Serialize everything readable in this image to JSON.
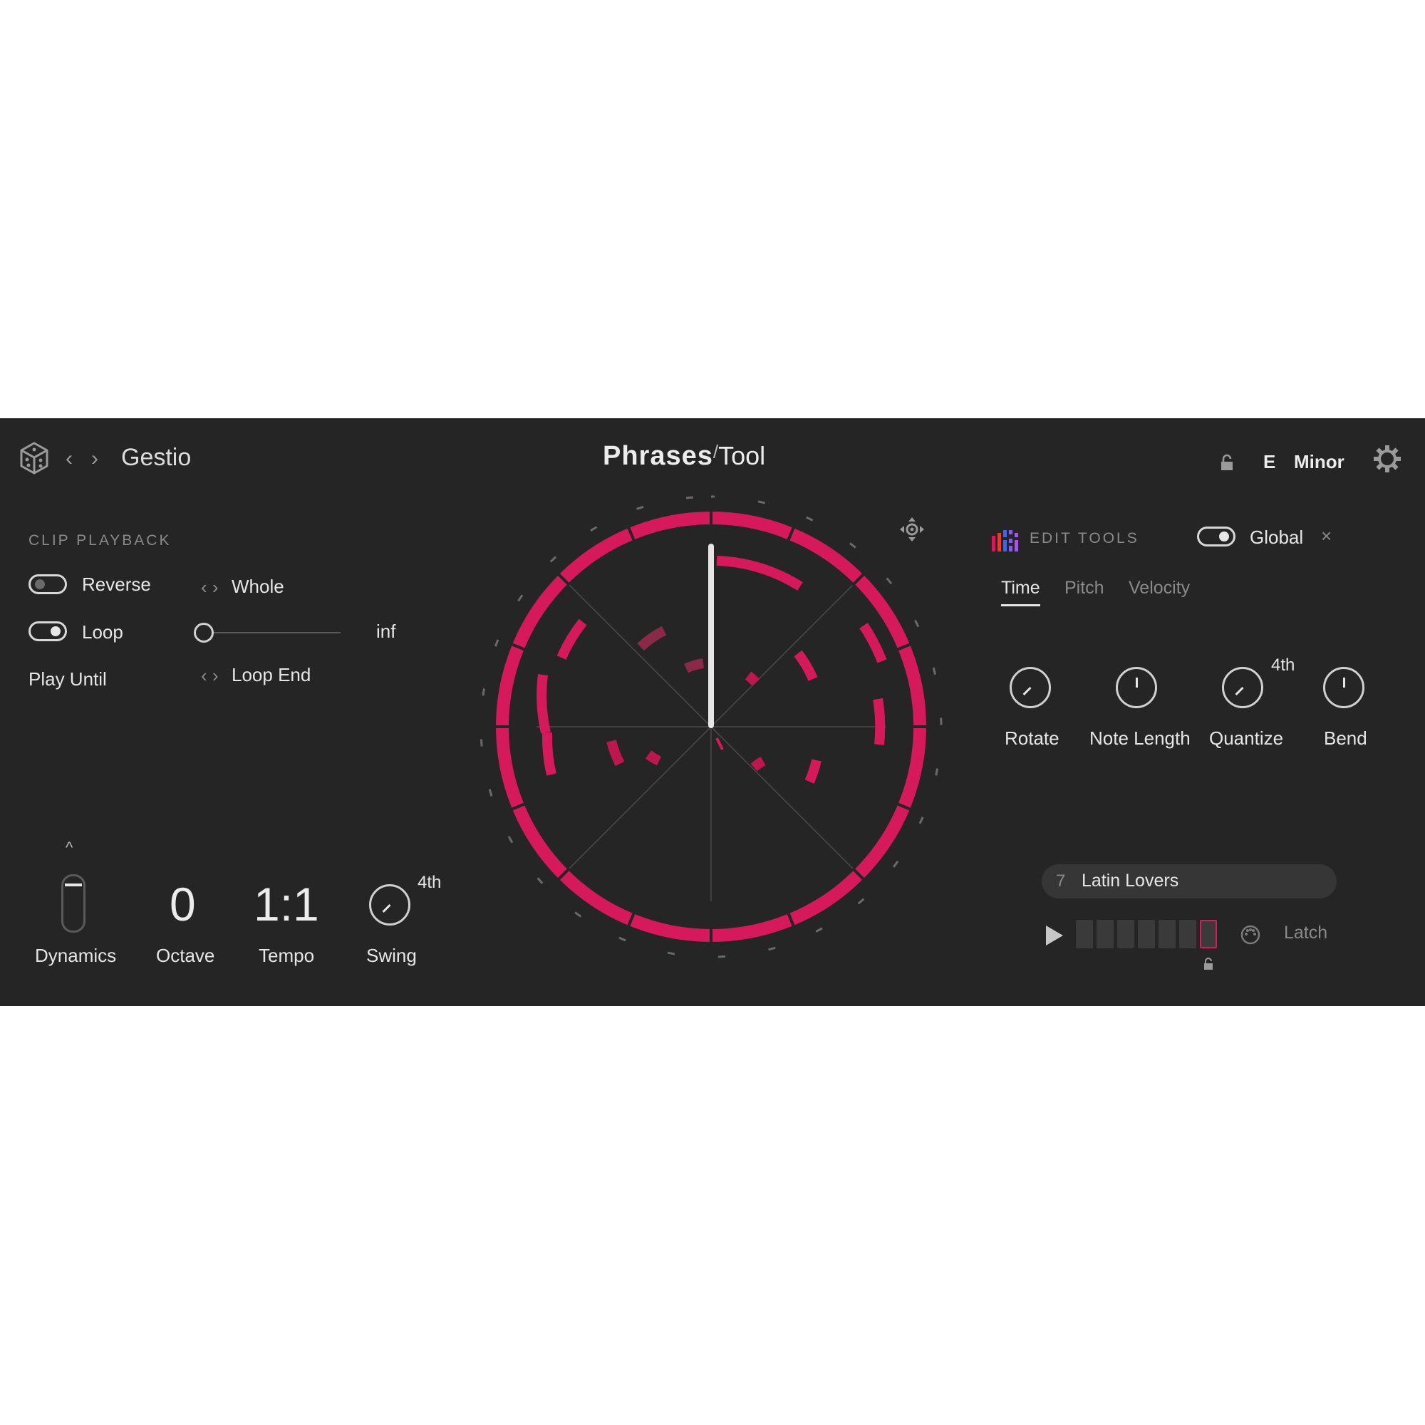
{
  "header": {
    "preset_name": "Gestio",
    "logo_main": "Phrases",
    "logo_sub": "Tool",
    "key": "E",
    "scale": "Minor"
  },
  "clip_playback": {
    "section_title": "CLIP PLAYBACK",
    "reverse_label": "Reverse",
    "loop_label": "Loop",
    "play_until_label": "Play Until",
    "whole_label": "Whole",
    "loop_end_label": "Loop End",
    "loop_count_value": "inf",
    "reverse_on": false,
    "loop_on": true
  },
  "bottom_controls": {
    "dynamics_label": "Dynamics",
    "octave_value": "0",
    "octave_label": "Octave",
    "tempo_value": "1:1",
    "tempo_label": "Tempo",
    "swing_value": "4th",
    "swing_label": "Swing"
  },
  "edit_tools": {
    "title": "EDIT TOOLS",
    "global_label": "Global",
    "tabs": [
      "Time",
      "Pitch",
      "Velocity"
    ],
    "active_tab": "Time",
    "knobs": [
      {
        "label": "Rotate"
      },
      {
        "label": "Note Length"
      },
      {
        "label": "Quantize",
        "value": "4th"
      },
      {
        "label": "Bend"
      }
    ]
  },
  "phrase": {
    "number": "7",
    "name": "Latin Lovers",
    "latch_label": "Latch"
  },
  "colors": {
    "accent": "#d5195a",
    "background": "#252525",
    "text": "#e6e6e6",
    "muted": "#8a8a8a"
  }
}
